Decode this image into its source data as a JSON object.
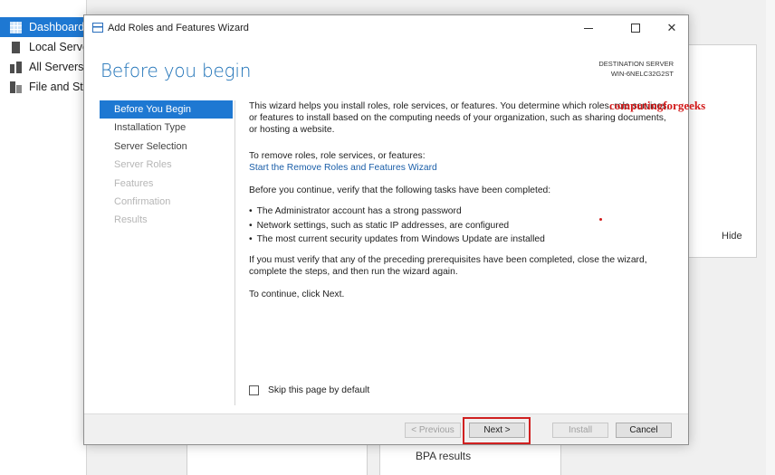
{
  "background": {
    "sidebar": [
      {
        "label": "Dashboard",
        "icon": "dashboard-icon",
        "active": true
      },
      {
        "label": "Local Server",
        "icon": "server-icon",
        "active": false
      },
      {
        "label": "All Servers",
        "icon": "all-servers-icon",
        "active": false
      },
      {
        "label": "File and Storage Services",
        "icon": "file-storage-icon",
        "active": false
      }
    ],
    "hide_label": "Hide",
    "bpa_label": "BPA results"
  },
  "wizard": {
    "title": "Add Roles and Features Wizard",
    "heading": "Before you begin",
    "destination_label": "DESTINATION SERVER",
    "destination_name": "WIN-6NELC32G2ST",
    "watermark": "computingforgeeks",
    "nav": [
      {
        "label": "Before You Begin",
        "state": "active"
      },
      {
        "label": "Installation Type",
        "state": "enabled"
      },
      {
        "label": "Server Selection",
        "state": "enabled"
      },
      {
        "label": "Server Roles",
        "state": "disabled"
      },
      {
        "label": "Features",
        "state": "disabled"
      },
      {
        "label": "Confirmation",
        "state": "disabled"
      },
      {
        "label": "Results",
        "state": "disabled"
      }
    ],
    "content": {
      "intro": "This wizard helps you install roles, role services, or features. You determine which roles, role services, or features to install based on the computing needs of your organization, such as sharing documents, or hosting a website.",
      "remove_text": "To remove roles, role services, or features:",
      "remove_link": "Start the Remove Roles and Features Wizard",
      "verify_text": "Before you continue, verify that the following tasks have been completed:",
      "bullets": [
        "The Administrator account has a strong password",
        "Network settings, such as static IP addresses, are configured",
        "The most current security updates from Windows Update are installed"
      ],
      "prereq_text": "If you must verify that any of the preceding prerequisites have been completed, close the wizard, complete the steps, and then run the wizard again.",
      "continue_text": "To continue, click Next."
    },
    "skip_label": "Skip this page by default",
    "buttons": {
      "previous": "< Previous",
      "next": "Next >",
      "install": "Install",
      "cancel": "Cancel"
    }
  }
}
